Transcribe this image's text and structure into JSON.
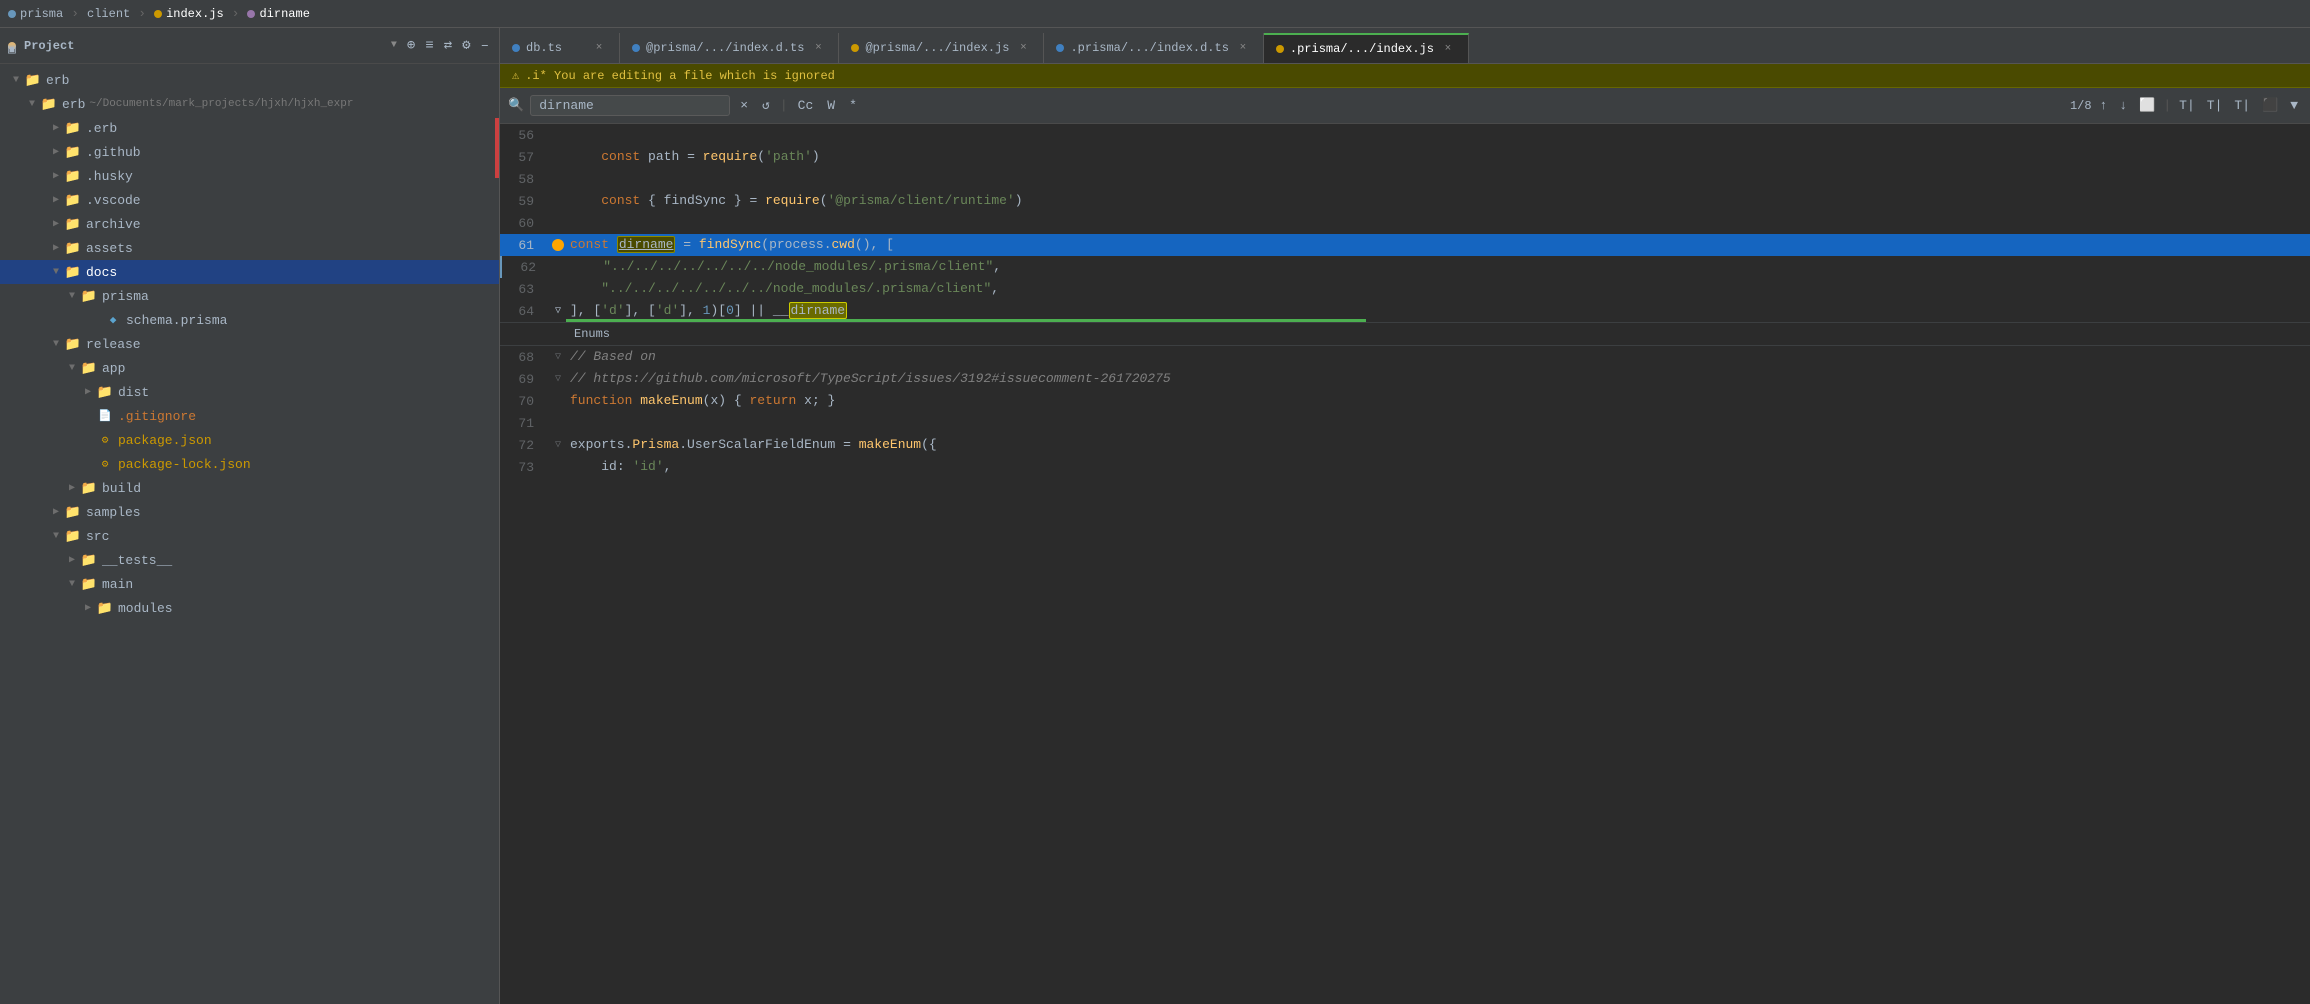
{
  "titlebar": {
    "items": [
      {
        "label": "prisma",
        "type": "folder",
        "icon": "folder-icon"
      },
      {
        "label": "client",
        "type": "folder",
        "icon": "folder-icon"
      },
      {
        "label": "index.js",
        "type": "js",
        "icon": "js-icon"
      },
      {
        "label": "dirname",
        "type": "var",
        "icon": "var-icon"
      }
    ]
  },
  "sidebar": {
    "header": "Project",
    "icons": [
      "⊕",
      "≡",
      "⇄",
      "⚙",
      "–"
    ],
    "tree": [
      {
        "id": "erb-root",
        "label": "erb",
        "type": "folder",
        "open": true,
        "depth": 0
      },
      {
        "id": "erb-sub",
        "label": "erb",
        "type": "folder",
        "open": true,
        "depth": 1,
        "hint": "~/Documents/mark_projects/hjxh/hjxh_expr"
      },
      {
        "id": "erb-folder",
        "label": ".erb",
        "type": "folder",
        "open": false,
        "depth": 2
      },
      {
        "id": "github-folder",
        "label": ".github",
        "type": "folder",
        "open": false,
        "depth": 2
      },
      {
        "id": "husky-folder",
        "label": ".husky",
        "type": "folder",
        "open": false,
        "depth": 2
      },
      {
        "id": "vscode-folder",
        "label": ".vscode",
        "type": "folder",
        "open": false,
        "depth": 2
      },
      {
        "id": "archive-folder",
        "label": "archive",
        "type": "folder",
        "open": false,
        "depth": 2
      },
      {
        "id": "assets-folder",
        "label": "assets",
        "type": "folder",
        "open": false,
        "depth": 2
      },
      {
        "id": "docs-folder",
        "label": "docs",
        "type": "folder",
        "open": true,
        "depth": 2,
        "selected": true
      },
      {
        "id": "prisma-folder",
        "label": "prisma",
        "type": "folder",
        "open": true,
        "depth": 3
      },
      {
        "id": "schema-file",
        "label": "schema.prisma",
        "type": "prisma",
        "depth": 4
      },
      {
        "id": "release-folder",
        "label": "release",
        "type": "folder",
        "open": true,
        "depth": 2
      },
      {
        "id": "app-folder",
        "label": "app",
        "type": "folder",
        "open": true,
        "depth": 3
      },
      {
        "id": "dist-folder",
        "label": "dist",
        "type": "folder",
        "open": false,
        "depth": 4
      },
      {
        "id": "gitignore-file",
        "label": ".gitignore",
        "type": "gitignore",
        "depth": 4
      },
      {
        "id": "package-json-file",
        "label": "package.json",
        "type": "json",
        "depth": 4
      },
      {
        "id": "package-lock-file",
        "label": "package-lock.json",
        "type": "json",
        "depth": 4
      },
      {
        "id": "build-folder",
        "label": "build",
        "type": "folder",
        "open": false,
        "depth": 3
      },
      {
        "id": "samples-folder",
        "label": "samples",
        "type": "folder",
        "open": false,
        "depth": 2
      },
      {
        "id": "src-folder",
        "label": "src",
        "type": "folder",
        "open": true,
        "depth": 2
      },
      {
        "id": "tests-folder",
        "label": "__tests__",
        "type": "folder",
        "open": false,
        "depth": 3
      },
      {
        "id": "main-folder",
        "label": "main",
        "type": "folder",
        "open": true,
        "depth": 3
      },
      {
        "id": "modules-folder",
        "label": "modules",
        "type": "folder",
        "open": false,
        "depth": 4
      }
    ]
  },
  "tabs": [
    {
      "id": "db-ts",
      "label": "db.ts",
      "type": "ts",
      "active": false,
      "closeable": true
    },
    {
      "id": "index-d-ts-1",
      "label": "@prisma/.../index.d.ts",
      "type": "ts",
      "active": false,
      "closeable": true
    },
    {
      "id": "index-js-1",
      "label": "@prisma/.../index.js",
      "type": "js",
      "active": false,
      "closeable": true
    },
    {
      "id": "index-d-ts-2",
      "label": ".prisma/.../index.d.ts",
      "type": "ts",
      "active": false,
      "closeable": true
    },
    {
      "id": "index-js-2",
      "label": ".prisma/.../index.js",
      "type": "js",
      "active": true,
      "closeable": true
    }
  ],
  "warning": {
    "icon": "⚠",
    "text": ".i* You are editing a file which is ignored"
  },
  "search": {
    "placeholder": "dirname",
    "value": "dirname",
    "count": "1/8",
    "buttons": [
      "×",
      "↺",
      "Cc",
      "W",
      "*",
      "↑",
      "↓",
      "⬜",
      "T|",
      "T|",
      "T|",
      "⬛",
      "▼"
    ]
  },
  "code": {
    "lines": [
      {
        "num": 56,
        "content": "",
        "type": "blank"
      },
      {
        "num": 57,
        "content": "    const path = require('path')",
        "type": "code"
      },
      {
        "num": 58,
        "content": "",
        "type": "blank"
      },
      {
        "num": 59,
        "content": "    const { findSync } = require('@prisma/client/runtime')",
        "type": "code"
      },
      {
        "num": 60,
        "content": "",
        "type": "blank"
      },
      {
        "num": 61,
        "content": "const dirname = findSync(process.cwd(), [",
        "type": "code",
        "highlighted": true,
        "hasFold": true,
        "hasOrangeDot": true,
        "searchWord": "dirname"
      },
      {
        "num": 62,
        "content": "    \"../../../../../../../node_modules/.prisma/client\",",
        "type": "code",
        "hasCursor": true
      },
      {
        "num": 63,
        "content": "    \"../../../../../../../node_modules/.prisma/client\",",
        "type": "code"
      },
      {
        "num": 64,
        "content": "], ['d'], ['d'], 1)[0] || __dirname",
        "type": "code",
        "hasFold": true,
        "hasGreenBar": true,
        "searchWord2": "dirname"
      },
      {
        "num": "enums",
        "content": "Enums",
        "type": "enums"
      },
      {
        "num": 68,
        "content": "// Based on",
        "type": "code",
        "hasFold": true,
        "comment": true
      },
      {
        "num": 69,
        "content": "// https://github.com/microsoft/TypeScript/issues/3192#issuecomment-261720275",
        "type": "code",
        "hasFold": true,
        "comment": true
      },
      {
        "num": 70,
        "content": "function makeEnum(x) { return x; }",
        "type": "code"
      },
      {
        "num": 71,
        "content": "",
        "type": "blank"
      },
      {
        "num": 72,
        "content": "exports.Prisma.UserScalarFieldEnum = makeEnum({",
        "type": "code",
        "hasFold": true
      },
      {
        "num": 73,
        "content": "    id: 'id',",
        "type": "code"
      }
    ]
  },
  "colors": {
    "bg": "#2b2b2b",
    "sidebar_bg": "#3c3f41",
    "selected": "#214283",
    "tab_active_bg": "#2b2b2b",
    "keyword": "#cc7832",
    "string": "#6a8759",
    "function": "#ffc66d",
    "comment": "#808080",
    "number": "#6897bb",
    "highlight_line": "#1565c0",
    "green_bar": "#4caf50",
    "warning_bg": "#4a4a00"
  }
}
